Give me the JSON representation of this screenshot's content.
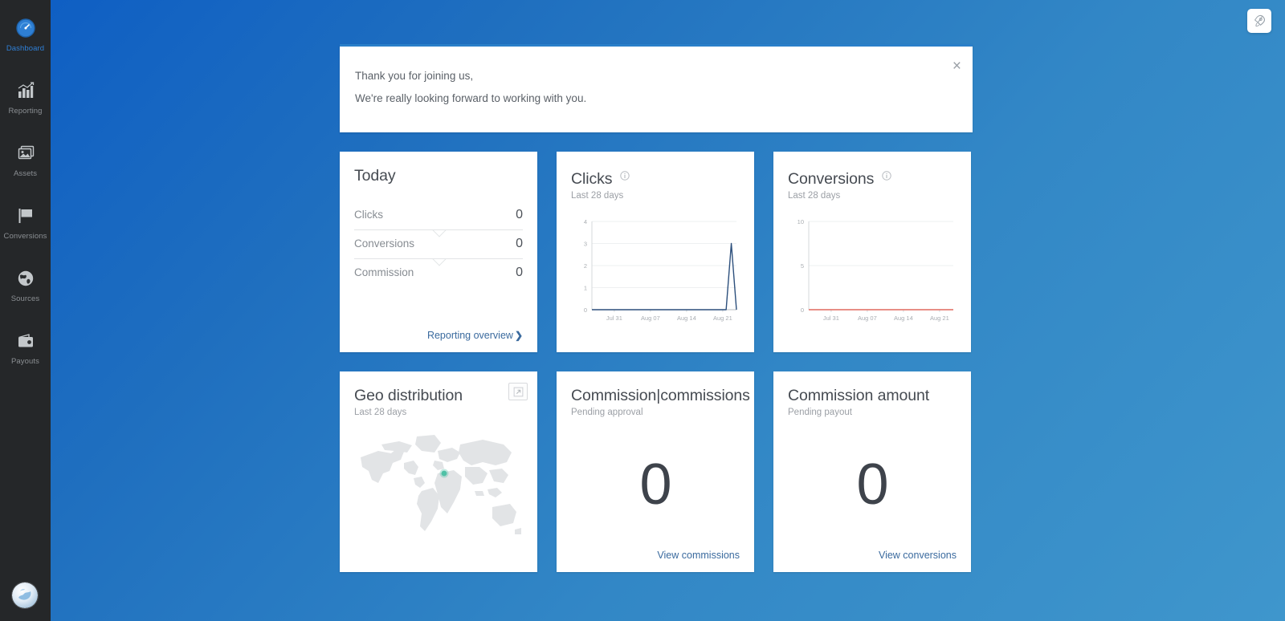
{
  "theme": {
    "background_gradient_from": "#0d5dc4",
    "background_gradient_to": "#3f96cc",
    "sidebar_bg": "#252729",
    "accent": "#2a7fc9",
    "link_color": "#3a6a9e",
    "clicks_line_color": "#2c4f7c",
    "conversions_line_color": "#e0695f",
    "geo_marker_color": "#4fc1a6"
  },
  "sidebar": {
    "items": [
      {
        "label": "Dashboard",
        "icon": "speedometer-icon",
        "active": true
      },
      {
        "label": "Reporting",
        "icon": "bar-chart-icon",
        "active": false
      },
      {
        "label": "Assets",
        "icon": "images-icon",
        "active": false
      },
      {
        "label": "Conversions",
        "icon": "flag-icon",
        "active": false
      },
      {
        "label": "Sources",
        "icon": "globe-icon",
        "active": false
      },
      {
        "label": "Payouts",
        "icon": "wallet-icon",
        "active": false
      }
    ],
    "avatar": {
      "icon": "user-avatar-globe"
    }
  },
  "fab": {
    "icon": "rocket-icon"
  },
  "banner": {
    "line1": "Thank you for joining us,",
    "line2": "We're really looking forward to working with you.",
    "close_label": "×"
  },
  "cards": {
    "today": {
      "title": "Today",
      "stats": [
        {
          "label": "Clicks",
          "value": "0"
        },
        {
          "label": "Conversions",
          "value": "0"
        },
        {
          "label": "Commission",
          "value": "0"
        }
      ],
      "footer_link": "Reporting overview",
      "footer_chevron": "❯"
    },
    "clicks": {
      "title": "Clicks",
      "subtitle": "Last 28 days",
      "info_icon": "info-circle-icon"
    },
    "conversions": {
      "title": "Conversions",
      "subtitle": "Last 28 days",
      "info_icon": "info-circle-icon"
    },
    "geo": {
      "title": "Geo distribution",
      "subtitle": "Last 28 days",
      "expand_icon": "expand-arrow-icon"
    },
    "commission_count": {
      "title": "Commission|commissions",
      "subtitle": "Pending approval",
      "value": "0",
      "footer_link": "View commissions"
    },
    "commission_amount": {
      "title": "Commission amount",
      "subtitle": "Pending payout",
      "value": "0",
      "footer_link": "View conversions"
    }
  },
  "chart_data": [
    {
      "type": "line",
      "title": "Clicks",
      "subtitle": "Last 28 days",
      "xlabel": "",
      "ylabel": "",
      "ylim": [
        0,
        4
      ],
      "yticks": [
        0,
        1,
        2,
        3,
        4
      ],
      "xticks": [
        "Jul 31",
        "Aug 07",
        "Aug 14",
        "Aug 21"
      ],
      "grid": true,
      "legend": "none",
      "x": [
        "Jul 26",
        "Jul 27",
        "Jul 28",
        "Jul 29",
        "Jul 30",
        "Jul 31",
        "Aug 01",
        "Aug 02",
        "Aug 03",
        "Aug 04",
        "Aug 05",
        "Aug 06",
        "Aug 07",
        "Aug 08",
        "Aug 09",
        "Aug 10",
        "Aug 11",
        "Aug 12",
        "Aug 13",
        "Aug 14",
        "Aug 15",
        "Aug 16",
        "Aug 17",
        "Aug 18",
        "Aug 19",
        "Aug 20",
        "Aug 21",
        "Aug 22",
        "Aug 23"
      ],
      "values": [
        0,
        0,
        0,
        0,
        0,
        0,
        0,
        0,
        0,
        0,
        0,
        0,
        0,
        0,
        0,
        0,
        0,
        0,
        0,
        0,
        0,
        0,
        0,
        0,
        0,
        0,
        0,
        3,
        0
      ]
    },
    {
      "type": "line",
      "title": "Conversions",
      "subtitle": "Last 28 days",
      "xlabel": "",
      "ylabel": "",
      "ylim": [
        0,
        10
      ],
      "yticks": [
        0,
        5,
        10
      ],
      "xticks": [
        "Jul 31",
        "Aug 07",
        "Aug 14",
        "Aug 21"
      ],
      "grid": true,
      "legend": "none",
      "x": [
        "Jul 26",
        "Jul 27",
        "Jul 28",
        "Jul 29",
        "Jul 30",
        "Jul 31",
        "Aug 01",
        "Aug 02",
        "Aug 03",
        "Aug 04",
        "Aug 05",
        "Aug 06",
        "Aug 07",
        "Aug 08",
        "Aug 09",
        "Aug 10",
        "Aug 11",
        "Aug 12",
        "Aug 13",
        "Aug 14",
        "Aug 15",
        "Aug 16",
        "Aug 17",
        "Aug 18",
        "Aug 19",
        "Aug 20",
        "Aug 21",
        "Aug 22",
        "Aug 23"
      ],
      "values": [
        0,
        0,
        0,
        0,
        0,
        0,
        0,
        0,
        0,
        0,
        0,
        0,
        0,
        0,
        0,
        0,
        0,
        0,
        0,
        0,
        0,
        0,
        0,
        0,
        0,
        0,
        0,
        0,
        0
      ]
    }
  ]
}
